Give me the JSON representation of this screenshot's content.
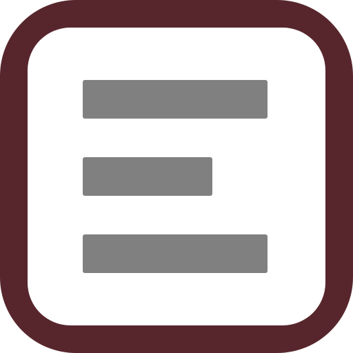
{
  "icon": {
    "name": "text-align-left-icon",
    "colors": {
      "frame": "#57262C",
      "background": "#FFFFFF",
      "lines": "#808080"
    }
  }
}
